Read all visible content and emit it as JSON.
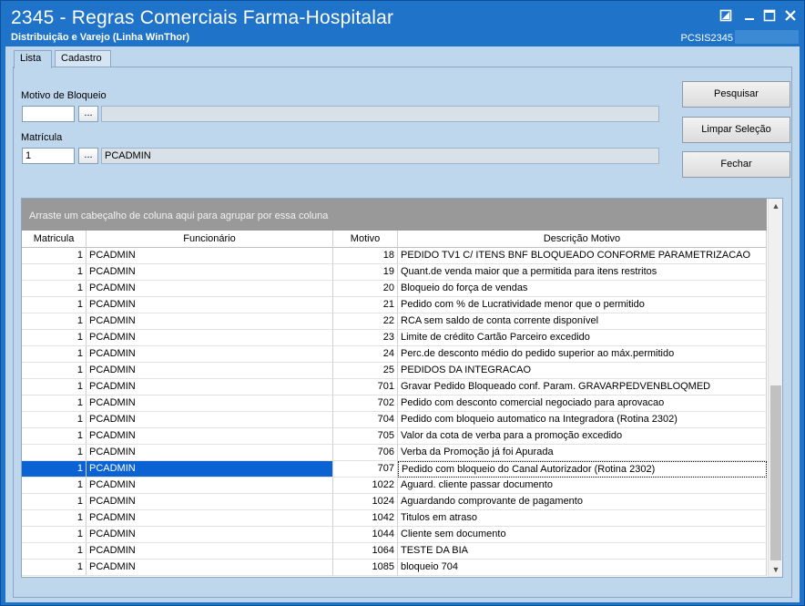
{
  "window": {
    "title": "2345 - Regras Comerciais Farma-Hospitalar",
    "subtitle": "Distribuição e Varejo (Linha WinThor)",
    "system_code": "PCSIS2345"
  },
  "tabs": [
    {
      "label": "Lista",
      "active": true
    },
    {
      "label": "Cadastro",
      "active": false
    }
  ],
  "filters": {
    "motivo_label": "Motivo de Bloqueio",
    "motivo_value": "",
    "motivo_desc": "",
    "matricula_label": "Matrícula",
    "matricula_value": "1",
    "matricula_desc": "PCADMIN",
    "ellipsis": "..."
  },
  "buttons": {
    "pesquisar": "Pesquisar",
    "limpar": "Limpar Seleção",
    "fechar": "Fechar"
  },
  "grid": {
    "group_hint": "Arraste um cabeçalho de coluna aqui para agrupar por essa coluna",
    "columns": [
      "Matricula",
      "Funcionário",
      "Motivo",
      "Descrição Motivo"
    ],
    "rows": [
      {
        "mat": "1",
        "fun": "PCADMIN",
        "mot": "18",
        "desc": "PEDIDO TV1 C/ ITENS BNF BLOQUEADO CONFORME PARAMETRIZACAO"
      },
      {
        "mat": "1",
        "fun": "PCADMIN",
        "mot": "19",
        "desc": "Quant.de venda maior que a permitida para itens restritos"
      },
      {
        "mat": "1",
        "fun": "PCADMIN",
        "mot": "20",
        "desc": "Bloqueio do força de vendas"
      },
      {
        "mat": "1",
        "fun": "PCADMIN",
        "mot": "21",
        "desc": "Pedido com % de Lucratividade menor que o permitido"
      },
      {
        "mat": "1",
        "fun": "PCADMIN",
        "mot": "22",
        "desc": "RCA sem saldo de conta corrente disponível"
      },
      {
        "mat": "1",
        "fun": "PCADMIN",
        "mot": "23",
        "desc": "Limite de crédito Cartão Parceiro excedido"
      },
      {
        "mat": "1",
        "fun": "PCADMIN",
        "mot": "24",
        "desc": "Perc.de desconto médio do pedido superior ao máx.permitido"
      },
      {
        "mat": "1",
        "fun": "PCADMIN",
        "mot": "25",
        "desc": "PEDIDOS DA INTEGRACAO"
      },
      {
        "mat": "1",
        "fun": "PCADMIN",
        "mot": "701",
        "desc": "Gravar Pedido Bloqueado conf. Param. GRAVARPEDVENBLOQMED"
      },
      {
        "mat": "1",
        "fun": "PCADMIN",
        "mot": "702",
        "desc": "Pedido com desconto comercial negociado para aprovacao"
      },
      {
        "mat": "1",
        "fun": "PCADMIN",
        "mot": "704",
        "desc": "Pedido com bloqueio automatico na Integradora (Rotina 2302)"
      },
      {
        "mat": "1",
        "fun": "PCADMIN",
        "mot": "705",
        "desc": "Valor da cota de verba para a promoção excedido"
      },
      {
        "mat": "1",
        "fun": "PCADMIN",
        "mot": "706",
        "desc": "Verba da Promoção já foi Apurada"
      },
      {
        "mat": "1",
        "fun": "PCADMIN",
        "mot": "707",
        "desc": "Pedido com bloqueio do Canal Autorizador (Rotina 2302)",
        "selected": true
      },
      {
        "mat": "1",
        "fun": "PCADMIN",
        "mot": "1022",
        "desc": "Aguard. cliente passar documento"
      },
      {
        "mat": "1",
        "fun": "PCADMIN",
        "mot": "1024",
        "desc": "Aguardando comprovante de pagamento"
      },
      {
        "mat": "1",
        "fun": "PCADMIN",
        "mot": "1042",
        "desc": "Titulos em atraso"
      },
      {
        "mat": "1",
        "fun": "PCADMIN",
        "mot": "1044",
        "desc": "Cliente sem documento"
      },
      {
        "mat": "1",
        "fun": "PCADMIN",
        "mot": "1064",
        "desc": "TESTE DA BIA"
      },
      {
        "mat": "1",
        "fun": "PCADMIN",
        "mot": "1085",
        "desc": " bloqueio 704"
      }
    ]
  },
  "colors": {
    "titlebar": "#1f73c9",
    "client_bg": "#bed7ed",
    "selection": "#0a62d3",
    "group_bar": "#999999"
  }
}
